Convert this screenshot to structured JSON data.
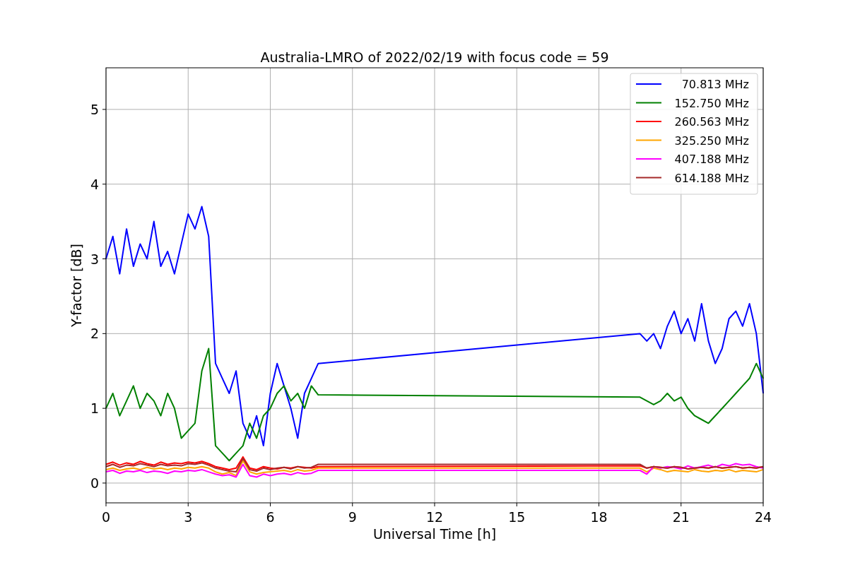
{
  "chart_data": {
    "type": "line",
    "title": "Australia-LMRO of 2022/02/19 with focus code = 59",
    "xlabel": "Universal Time [h]",
    "ylabel": "Y-factor [dB]",
    "x": [
      0,
      0.25,
      0.5,
      0.75,
      1,
      1.25,
      1.5,
      1.75,
      2,
      2.25,
      2.5,
      2.75,
      3,
      3.25,
      3.5,
      3.75,
      4,
      4.25,
      4.5,
      4.75,
      5,
      5.25,
      5.5,
      5.75,
      6,
      6.25,
      6.5,
      6.75,
      7,
      7.25,
      7.5,
      7.75,
      19.5,
      19.75,
      20,
      20.25,
      20.5,
      20.75,
      21,
      21.25,
      21.5,
      21.75,
      22,
      22.25,
      22.5,
      22.75,
      23,
      23.25,
      23.5,
      23.75,
      24
    ],
    "series": [
      {
        "name": "70.813 MHz",
        "color": "#0000ff",
        "values": [
          3.0,
          3.3,
          2.8,
          3.4,
          2.9,
          3.2,
          3.0,
          3.5,
          2.9,
          3.1,
          2.8,
          3.2,
          3.6,
          3.4,
          3.7,
          3.3,
          1.6,
          1.4,
          1.2,
          1.5,
          0.8,
          0.6,
          0.9,
          0.5,
          1.2,
          1.6,
          1.3,
          1.0,
          0.6,
          1.2,
          1.4,
          1.6,
          2.0,
          1.9,
          2.0,
          1.8,
          2.1,
          2.3,
          2.0,
          2.2,
          1.9,
          2.4,
          1.9,
          1.6,
          1.8,
          2.2,
          2.3,
          2.1,
          2.4,
          2.0,
          1.2
        ]
      },
      {
        "name": "152.750 MHz",
        "color": "#008000",
        "values": [
          1.0,
          1.2,
          0.9,
          1.1,
          1.3,
          1.0,
          1.2,
          1.1,
          0.9,
          1.2,
          1.0,
          0.6,
          0.7,
          0.8,
          1.5,
          1.8,
          0.5,
          0.4,
          0.3,
          0.4,
          0.5,
          0.8,
          0.6,
          0.9,
          1.0,
          1.2,
          1.3,
          1.1,
          1.2,
          1.0,
          1.3,
          1.18,
          1.15,
          1.1,
          1.05,
          1.1,
          1.2,
          1.1,
          1.15,
          1.0,
          0.9,
          0.85,
          0.8,
          0.9,
          1.0,
          1.1,
          1.2,
          1.3,
          1.4,
          1.6,
          1.4
        ]
      },
      {
        "name": "260.563 MHz",
        "color": "#ff0000",
        "values": [
          0.25,
          0.28,
          0.24,
          0.27,
          0.25,
          0.29,
          0.26,
          0.24,
          0.28,
          0.25,
          0.27,
          0.26,
          0.28,
          0.27,
          0.29,
          0.26,
          0.22,
          0.2,
          0.18,
          0.2,
          0.35,
          0.2,
          0.18,
          0.22,
          0.2,
          0.19,
          0.21,
          0.2,
          0.22,
          0.21,
          0.2,
          0.22,
          0.23,
          0.2,
          0.22,
          0.21,
          0.2,
          0.22,
          0.21,
          0.19,
          0.2,
          0.21,
          0.2,
          0.22,
          0.2,
          0.21,
          0.22,
          0.2,
          0.21,
          0.2,
          0.22
        ]
      },
      {
        "name": "325.250 MHz",
        "color": "#ffa500",
        "values": [
          0.18,
          0.2,
          0.17,
          0.19,
          0.2,
          0.18,
          0.21,
          0.19,
          0.2,
          0.18,
          0.2,
          0.19,
          0.21,
          0.2,
          0.22,
          0.2,
          0.15,
          0.12,
          0.14,
          0.1,
          0.3,
          0.15,
          0.12,
          0.14,
          0.15,
          0.16,
          0.17,
          0.15,
          0.18,
          0.16,
          0.17,
          0.2,
          0.2,
          0.15,
          0.2,
          0.18,
          0.15,
          0.17,
          0.16,
          0.15,
          0.18,
          0.16,
          0.15,
          0.17,
          0.16,
          0.18,
          0.15,
          0.17,
          0.16,
          0.15,
          0.18
        ]
      },
      {
        "name": "407.188 MHz",
        "color": "#ff00ff",
        "values": [
          0.15,
          0.17,
          0.13,
          0.16,
          0.15,
          0.17,
          0.14,
          0.16,
          0.15,
          0.13,
          0.16,
          0.15,
          0.17,
          0.16,
          0.18,
          0.15,
          0.12,
          0.1,
          0.11,
          0.08,
          0.25,
          0.1,
          0.08,
          0.12,
          0.1,
          0.12,
          0.13,
          0.11,
          0.14,
          0.12,
          0.13,
          0.17,
          0.17,
          0.12,
          0.22,
          0.2,
          0.22,
          0.21,
          0.19,
          0.23,
          0.2,
          0.22,
          0.24,
          0.21,
          0.25,
          0.23,
          0.26,
          0.24,
          0.25,
          0.22,
          0.2
        ]
      },
      {
        "name": "614.188 MHz",
        "color": "#a52a2a",
        "values": [
          0.22,
          0.25,
          0.21,
          0.24,
          0.23,
          0.26,
          0.24,
          0.22,
          0.25,
          0.23,
          0.24,
          0.23,
          0.26,
          0.25,
          0.27,
          0.24,
          0.2,
          0.18,
          0.16,
          0.15,
          0.33,
          0.18,
          0.16,
          0.2,
          0.18,
          0.2,
          0.21,
          0.19,
          0.22,
          0.2,
          0.21,
          0.25,
          0.25,
          0.2,
          0.22,
          0.21,
          0.2,
          0.22,
          0.21,
          0.19,
          0.2,
          0.21,
          0.2,
          0.22,
          0.2,
          0.21,
          0.22,
          0.2,
          0.21,
          0.2,
          0.22
        ]
      }
    ],
    "xlim": [
      0,
      24
    ],
    "ylim": [
      -0.265,
      5.557
    ],
    "xticks": [
      0,
      3,
      6,
      9,
      12,
      15,
      18,
      21,
      24
    ],
    "yticks": [
      0,
      1,
      2,
      3,
      4,
      5
    ],
    "grid": true,
    "legend": true
  }
}
